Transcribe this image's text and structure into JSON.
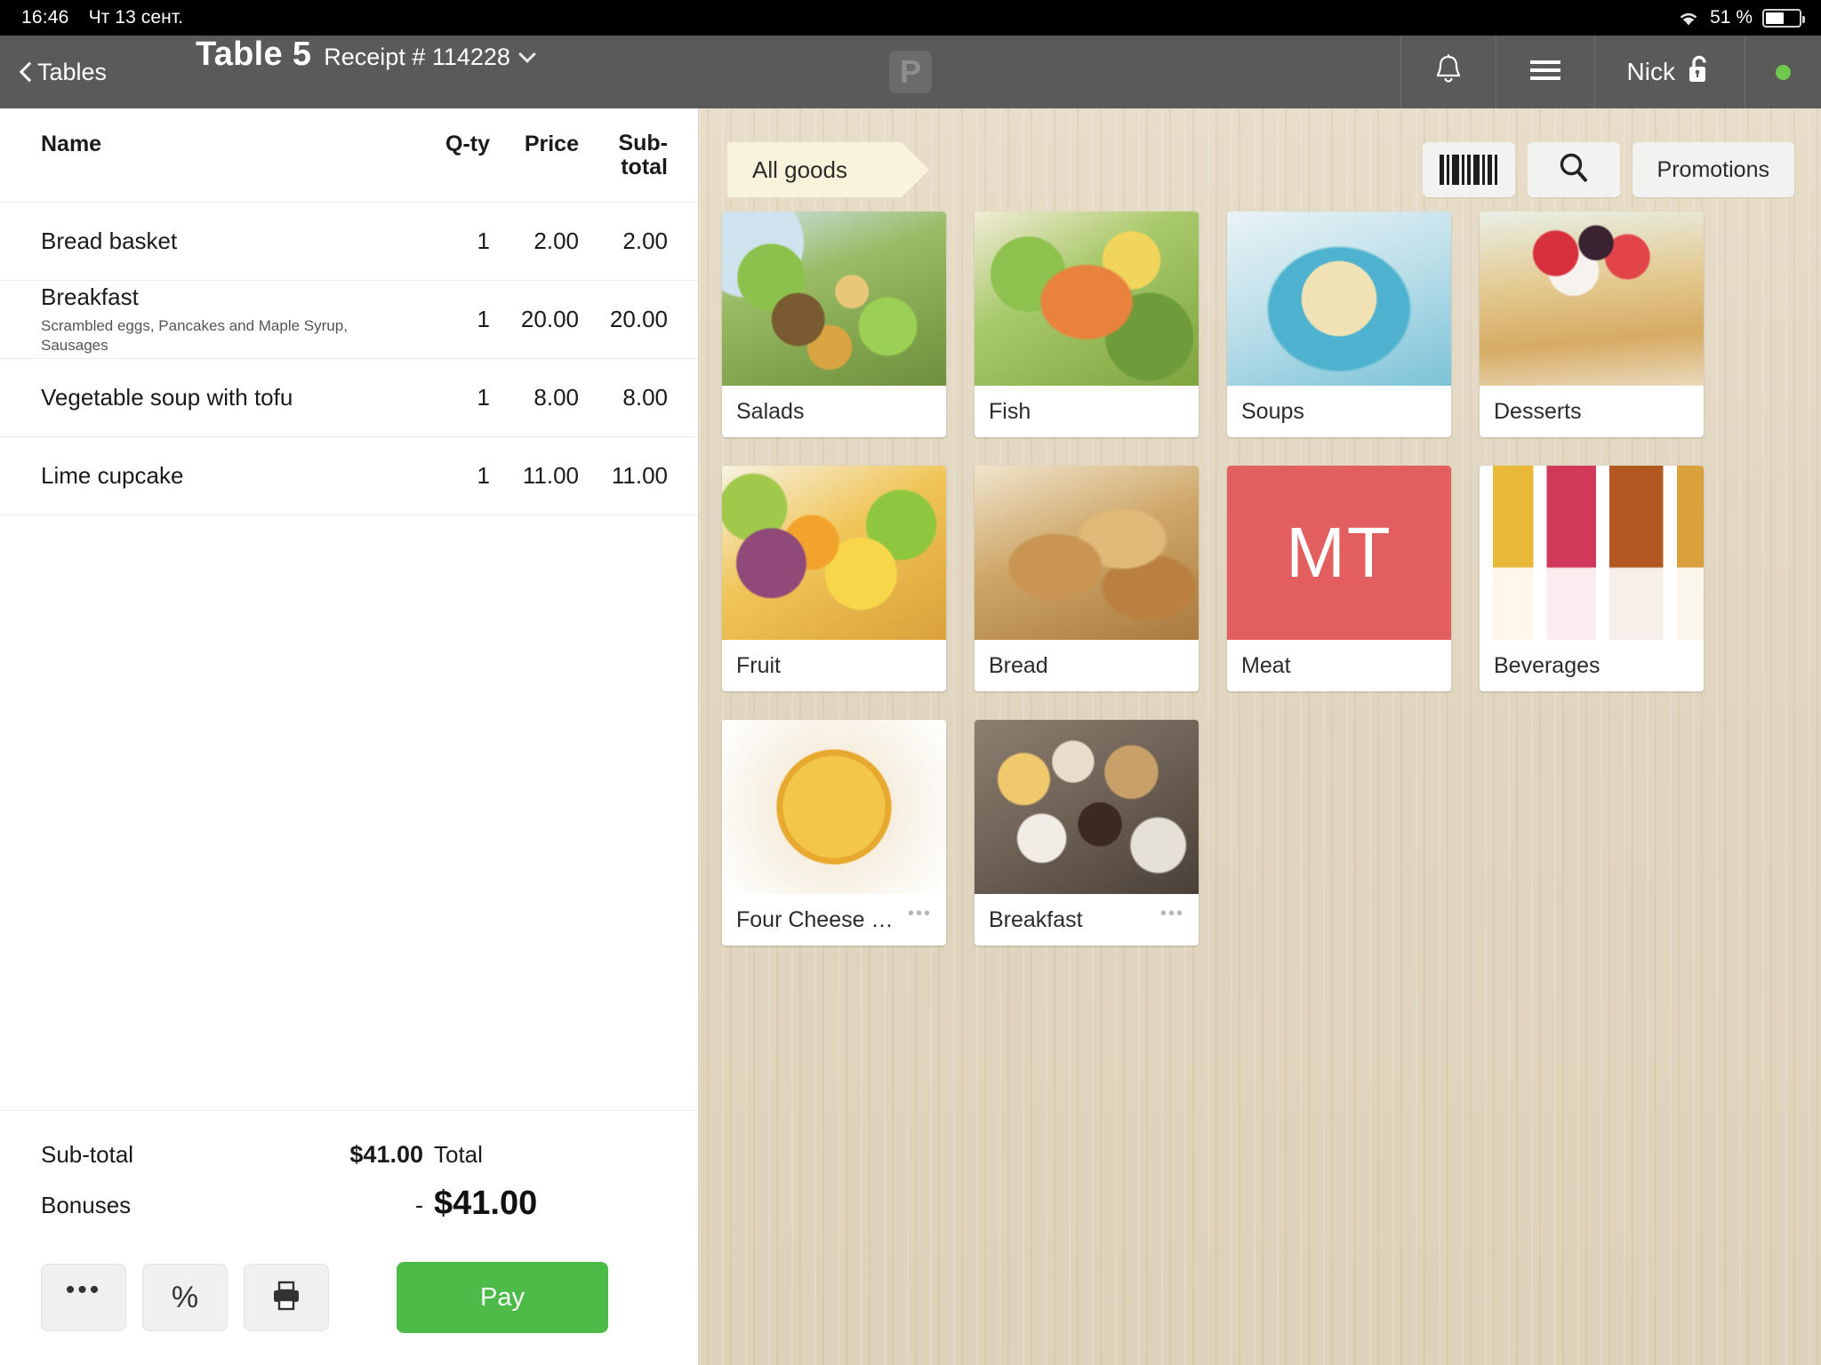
{
  "status_bar": {
    "time": "16:46",
    "date": "Чт 13 сент.",
    "battery_percent": "51 %",
    "battery_level": 51,
    "wifi_icon": "wifi-icon",
    "battery_icon": "battery-icon"
  },
  "nav": {
    "back_label": "Tables",
    "back_icon": "chevron-left-icon",
    "table_title": "Table 5",
    "receipt_label": "Receipt # 114228",
    "receipt_caret_icon": "chevron-down-icon",
    "logo_text": "P",
    "bell_icon": "bell-icon",
    "menu_icon": "hamburger-menu-icon",
    "user_name": "Nick",
    "lock_icon": "unlock-icon",
    "status_dot_color": "#6ec94f"
  },
  "receipt": {
    "columns": {
      "name": "Name",
      "qty": "Q-ty",
      "price": "Price",
      "subtotal_line1": "Sub-",
      "subtotal_line2": "total"
    },
    "items": [
      {
        "name": "Bread basket",
        "desc": "",
        "qty": "1",
        "price": "2.00",
        "subtotal": "2.00"
      },
      {
        "name": "Breakfast",
        "desc": "Scrambled eggs, Pancakes and Maple Syrup, Sausages",
        "qty": "1",
        "price": "20.00",
        "subtotal": "20.00"
      },
      {
        "name": "Vegetable soup with tofu",
        "desc": "",
        "qty": "1",
        "price": "8.00",
        "subtotal": "8.00"
      },
      {
        "name": "Lime cupcake",
        "desc": "",
        "qty": "1",
        "price": "11.00",
        "subtotal": "11.00"
      }
    ],
    "totals": {
      "subtotal_label": "Sub-total",
      "subtotal_value": "$41.00",
      "bonuses_label": "Bonuses",
      "bonuses_value": "-",
      "total_label": "Total",
      "total_value": "$41.00"
    },
    "actions": {
      "more_label": "•••",
      "more_icon": "ellipsis-icon",
      "discount_label": "%",
      "discount_icon": "percent-icon",
      "print_icon": "printer-icon",
      "pay_label": "Pay",
      "pay_color": "#4cbb47"
    }
  },
  "catalog": {
    "breadcrumb": "All goods",
    "barcode_icon": "barcode-icon",
    "search_icon": "search-icon",
    "promotions_label": "Promotions",
    "tiles": [
      {
        "label": "Salads",
        "image": "img-salads",
        "initials": "",
        "bg": "",
        "more": ""
      },
      {
        "label": "Fish",
        "image": "img-fish",
        "initials": "",
        "bg": "",
        "more": ""
      },
      {
        "label": "Soups",
        "image": "img-soups",
        "initials": "",
        "bg": "",
        "more": ""
      },
      {
        "label": "Desserts",
        "image": "img-desserts",
        "initials": "",
        "bg": "",
        "more": ""
      },
      {
        "label": "Fruit",
        "image": "img-fruit",
        "initials": "",
        "bg": "",
        "more": ""
      },
      {
        "label": "Bread",
        "image": "img-bread",
        "initials": "",
        "bg": "",
        "more": ""
      },
      {
        "label": "Meat",
        "image": "",
        "initials": "MT",
        "bg": "#e35f5f",
        "more": ""
      },
      {
        "label": "Beverages",
        "image": "img-beverages",
        "initials": "",
        "bg": "",
        "more": ""
      },
      {
        "label": "Four Cheese Pizza",
        "image": "img-pizza",
        "initials": "",
        "bg": "",
        "more": "•••"
      },
      {
        "label": "Breakfast",
        "image": "img-breakfast",
        "initials": "",
        "bg": "",
        "more": "•••"
      }
    ]
  }
}
